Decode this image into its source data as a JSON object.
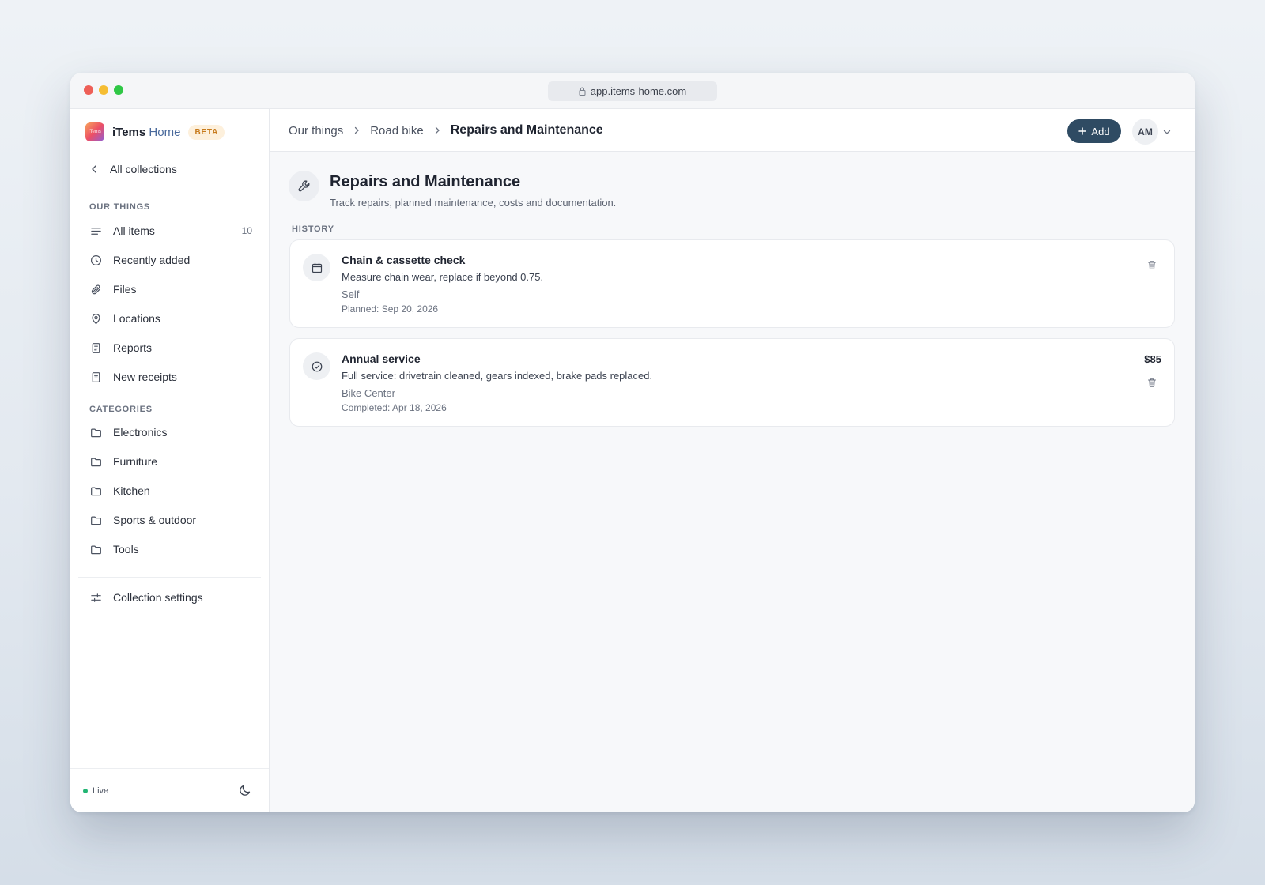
{
  "browser": {
    "url": "app.items-home.com"
  },
  "brand": {
    "name_part1": "iTems",
    "name_part2": "Home",
    "badge": "BETA",
    "logo_text": "iTems"
  },
  "sidebar": {
    "back_label": "All collections",
    "section_things": "OUR THINGS",
    "items": [
      {
        "label": "All items",
        "count": "10",
        "icon": "list-icon"
      },
      {
        "label": "Recently added",
        "icon": "clock-icon"
      },
      {
        "label": "Files",
        "icon": "paperclip-icon"
      },
      {
        "label": "Locations",
        "icon": "map-pin-icon"
      },
      {
        "label": "Reports",
        "icon": "document-icon"
      },
      {
        "label": "New receipts",
        "icon": "receipt-icon"
      }
    ],
    "section_categories": "CATEGORIES",
    "categories": [
      {
        "label": "Electronics",
        "icon": "folder-icon"
      },
      {
        "label": "Furniture",
        "icon": "folder-icon"
      },
      {
        "label": "Kitchen",
        "icon": "folder-icon"
      },
      {
        "label": "Sports & outdoor",
        "icon": "folder-icon"
      },
      {
        "label": "Tools",
        "icon": "folder-icon"
      }
    ],
    "settings_label": "Collection settings",
    "status": "Live"
  },
  "header": {
    "breadcrumbs": [
      "Our things",
      "Road bike",
      "Repairs and Maintenance"
    ],
    "add_label": "Add",
    "avatar_initials": "AM"
  },
  "page": {
    "title": "Repairs and Maintenance",
    "subtitle": "Track repairs, planned maintenance, costs and documentation.",
    "history_label": "HISTORY",
    "entries": [
      {
        "title": "Chain & cassette check",
        "description": "Measure chain wear, replace if beyond 0.75.",
        "provider": "Self",
        "date": "Planned: Sep 20, 2026",
        "cost": "",
        "icon": "calendar-icon"
      },
      {
        "title": "Annual service",
        "description": "Full service: drivetrain cleaned, gears indexed, brake pads replaced.",
        "provider": "Bike Center",
        "date": "Completed: Apr 18, 2026",
        "cost": "$85",
        "icon": "check-circle-icon"
      }
    ]
  },
  "colors": {
    "accent": "#2f4b63",
    "live": "#22b573",
    "beta_bg": "#fdf0dc",
    "beta_text": "#c77b1d"
  }
}
